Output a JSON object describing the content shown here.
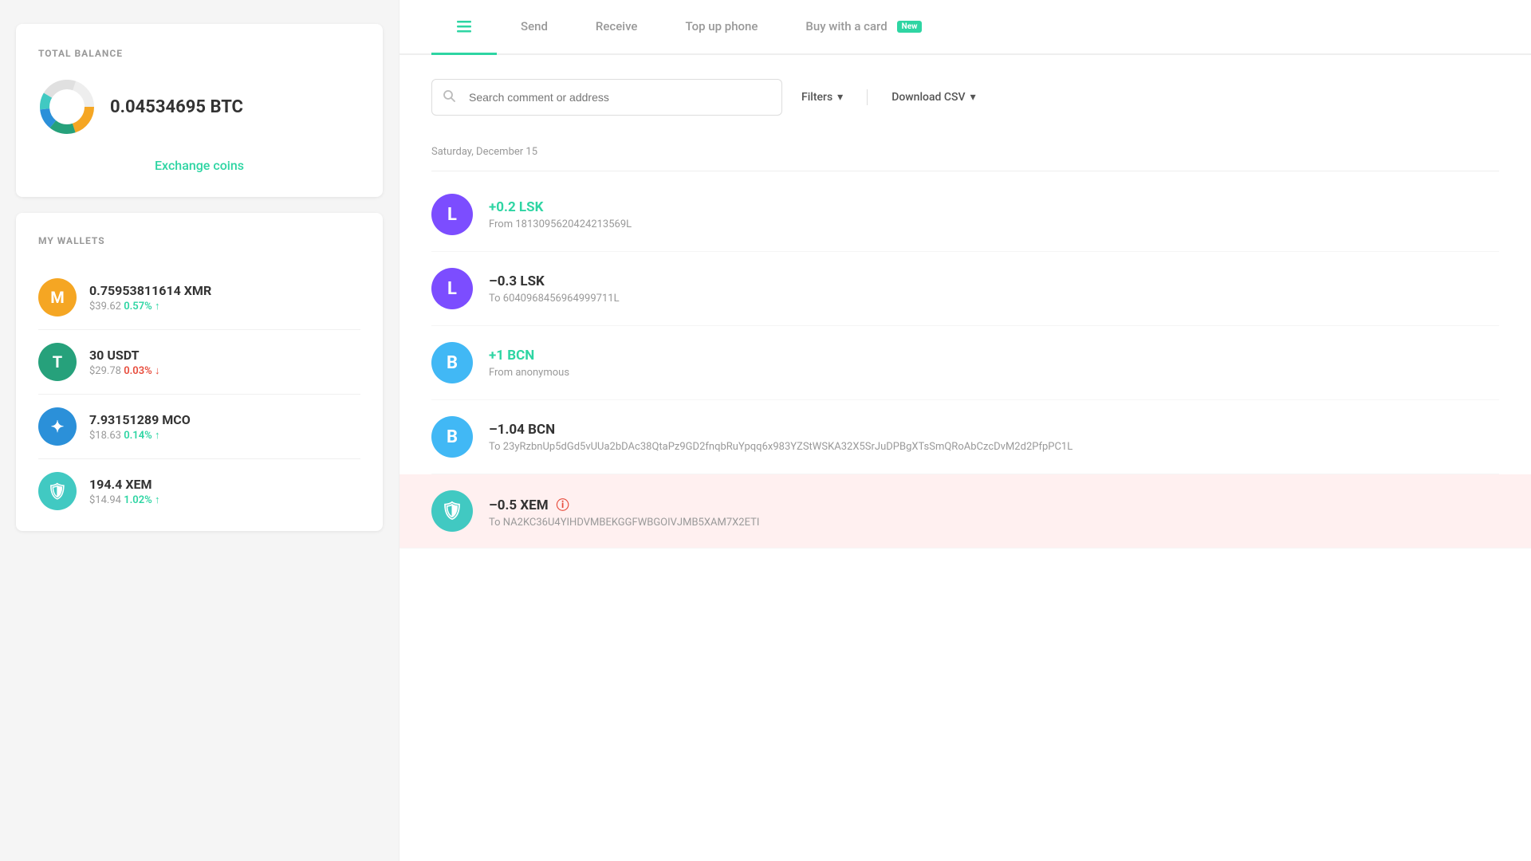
{
  "left": {
    "totalBalance": {
      "sectionTitle": "TOTAL BALANCE",
      "amount": "0.04534695 BTC",
      "exchangeLink": "Exchange coins"
    },
    "myWallets": {
      "sectionTitle": "MY WALLETS",
      "wallets": [
        {
          "symbol": "M",
          "name": "XMR",
          "amount": "0.75953811614 XMR",
          "fiat": "$39.62",
          "change": "0.57% ↑",
          "changeDir": "up",
          "bgColor": "#f5a623"
        },
        {
          "symbol": "T",
          "name": "USDT",
          "amount": "30 USDT",
          "fiat": "$29.78",
          "change": "0.03% ↓",
          "changeDir": "down",
          "bgColor": "#26a17b"
        },
        {
          "symbol": "✦",
          "name": "MCO",
          "amount": "7.93151289 MCO",
          "fiat": "$18.63",
          "change": "0.14% ↑",
          "changeDir": "up",
          "bgColor": "#2b90d9"
        },
        {
          "symbol": "🛡",
          "name": "XEM",
          "amount": "194.4 XEM",
          "fiat": "$14.94",
          "change": "1.02% ↑",
          "changeDir": "up",
          "bgColor": "#41c9c2"
        }
      ]
    }
  },
  "right": {
    "tabs": [
      {
        "id": "transactions",
        "label": "",
        "icon": "≡",
        "active": true
      },
      {
        "id": "send",
        "label": "Send",
        "icon": "",
        "active": false
      },
      {
        "id": "receive",
        "label": "Receive",
        "icon": "",
        "active": false
      },
      {
        "id": "topup",
        "label": "Top up phone",
        "icon": "",
        "active": false
      },
      {
        "id": "buywithcard",
        "label": "Buy with a card",
        "icon": "",
        "badge": "New",
        "active": false
      }
    ],
    "search": {
      "placeholder": "Search comment or address"
    },
    "filters": {
      "label": "Filters",
      "csvLabel": "Download CSV"
    },
    "dateSeparator": "Saturday, December 15",
    "transactions": [
      {
        "id": "tx1",
        "avatarLetter": "L",
        "avatarBg": "#7c4dff",
        "amount": "+0.2 LSK",
        "amountDir": "positive",
        "address": "From 181309562042421356​9L",
        "highlighted": false,
        "warning": false
      },
      {
        "id": "tx2",
        "avatarLetter": "L",
        "avatarBg": "#7c4dff",
        "amount": "–0.3 LSK",
        "amountDir": "negative",
        "address": "To 60409684569649997​11L",
        "highlighted": false,
        "warning": false
      },
      {
        "id": "tx3",
        "avatarLetter": "B",
        "avatarBg": "#41b8f5",
        "amount": "+1 BCN",
        "amountDir": "positive",
        "address": "From anonymous",
        "highlighted": false,
        "warning": false
      },
      {
        "id": "tx4",
        "avatarLetter": "B",
        "avatarBg": "#41b8f5",
        "amount": "–1.04 BCN",
        "amountDir": "negative",
        "address": "To 23yRzbnUp5dGd5vUUa2bDAc38QtaPz9GD2fnqbRuYpqq6x983YZStWSKA32X5SrJuDPBgXTsSmQRoAbCzcDvM2d2PfpPC1L",
        "highlighted": false,
        "warning": false
      },
      {
        "id": "tx5",
        "avatarLetter": "🛡",
        "avatarBg": "#41c9c2",
        "amount": "–0.5 XEM",
        "amountDir": "negative",
        "address": "To NA2KC36U4YIHDVMBEKGGFWBGOIVJMB5XAM7X2ETI",
        "highlighted": true,
        "warning": true
      }
    ]
  }
}
